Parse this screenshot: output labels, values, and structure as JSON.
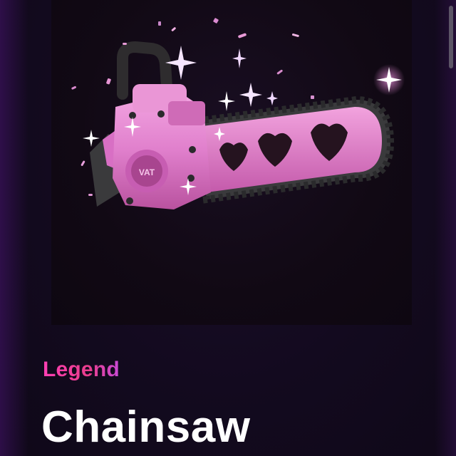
{
  "item": {
    "rarity": "Legend",
    "name": "Chainsaw",
    "image_label": "VAT",
    "image_icon": "pink-heart-chainsaw"
  },
  "colors": {
    "background": "#13091e",
    "rarity_pink": "#ff3fb4",
    "chainsaw_pink": "#e58bd2",
    "title_white": "#ffffff"
  }
}
